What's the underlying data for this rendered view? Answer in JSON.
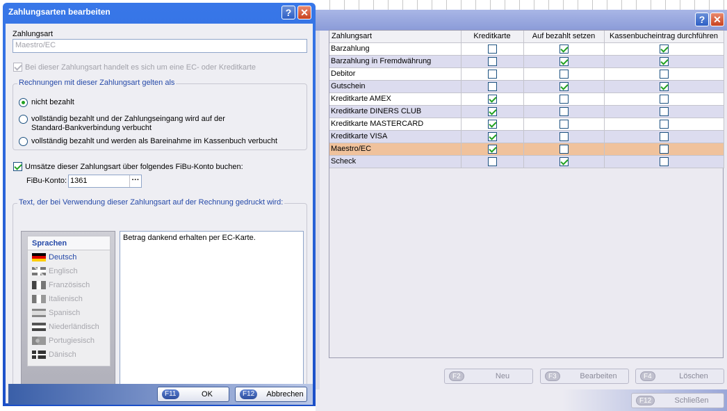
{
  "background": {
    "table": {
      "headers": [
        "Zahlungsart",
        "Kreditkarte",
        "Auf bezahlt setzen",
        "Kassenbucheintrag durchführen"
      ],
      "rows": [
        {
          "name": "Barzahlung",
          "credit": false,
          "paid": true,
          "cash": true
        },
        {
          "name": "Barzahlung in Fremdwährung",
          "credit": false,
          "paid": true,
          "cash": true
        },
        {
          "name": "Debitor",
          "credit": false,
          "paid": false,
          "cash": false
        },
        {
          "name": "Gutschein",
          "credit": false,
          "paid": true,
          "cash": true
        },
        {
          "name": "Kreditkarte AMEX",
          "credit": true,
          "paid": false,
          "cash": false
        },
        {
          "name": "Kreditkarte DINERS CLUB",
          "credit": true,
          "paid": false,
          "cash": false
        },
        {
          "name": "Kreditkarte MASTERCARD",
          "credit": true,
          "paid": false,
          "cash": false
        },
        {
          "name": "Kreditkarte VISA",
          "credit": true,
          "paid": false,
          "cash": false
        },
        {
          "name": "Maestro/EC",
          "credit": true,
          "paid": false,
          "cash": false,
          "selected": true
        },
        {
          "name": "Scheck",
          "credit": false,
          "paid": true,
          "cash": false
        }
      ]
    },
    "buttons": {
      "new": {
        "key": "F2",
        "label": "Neu"
      },
      "edit": {
        "key": "F3",
        "label": "Bearbeiten"
      },
      "delete": {
        "key": "F4",
        "label": "Löschen"
      },
      "close": {
        "key": "F12",
        "label": "Schließen"
      }
    },
    "title_buttons": {
      "help": "?",
      "close": "✕"
    }
  },
  "dialog": {
    "title": "Zahlungsarten bearbeiten",
    "title_buttons": {
      "help": "?",
      "close": "✕"
    },
    "payment_type_label": "Zahlungsart",
    "payment_type_value": "Maestro/EC",
    "ec_checkbox_label": "Bei dieser Zahlungsart handelt es sich um eine EC- oder Kreditkarte",
    "invoice_group": {
      "legend": "Rechnungen mit dieser Zahlungsart gelten als",
      "options": [
        "nicht bezahlt",
        "vollständig bezahlt und der Zahlungseingang wird auf der",
        "Standard-Bankverbindung verbucht",
        "vollständig bezahlt und werden als Bareinahme im Kassenbuch verbucht"
      ]
    },
    "fibu_checkbox_label": "Umsätze dieser Zahlungsart über folgendes FiBu-Konto buchen:",
    "fibu_label": "FiBu-Konto:",
    "fibu_value": "1361",
    "fibu_browse": "···",
    "text_group_legend": "Text, der bei Verwendung dieser Zahlungsart auf der Rechnung gedruckt wird:",
    "languages_header": "Sprachen",
    "languages": [
      "Deutsch",
      "Englisch",
      "Französisch",
      "Italienisch",
      "Spanisch",
      "Niederländisch",
      "Portugiesisch",
      "Dänisch"
    ],
    "print_text": "Betrag dankend erhalten per EC-Karte.",
    "ok": {
      "key": "F11",
      "label": "OK"
    },
    "cancel": {
      "key": "F12",
      "label": "Abbrechen"
    }
  }
}
